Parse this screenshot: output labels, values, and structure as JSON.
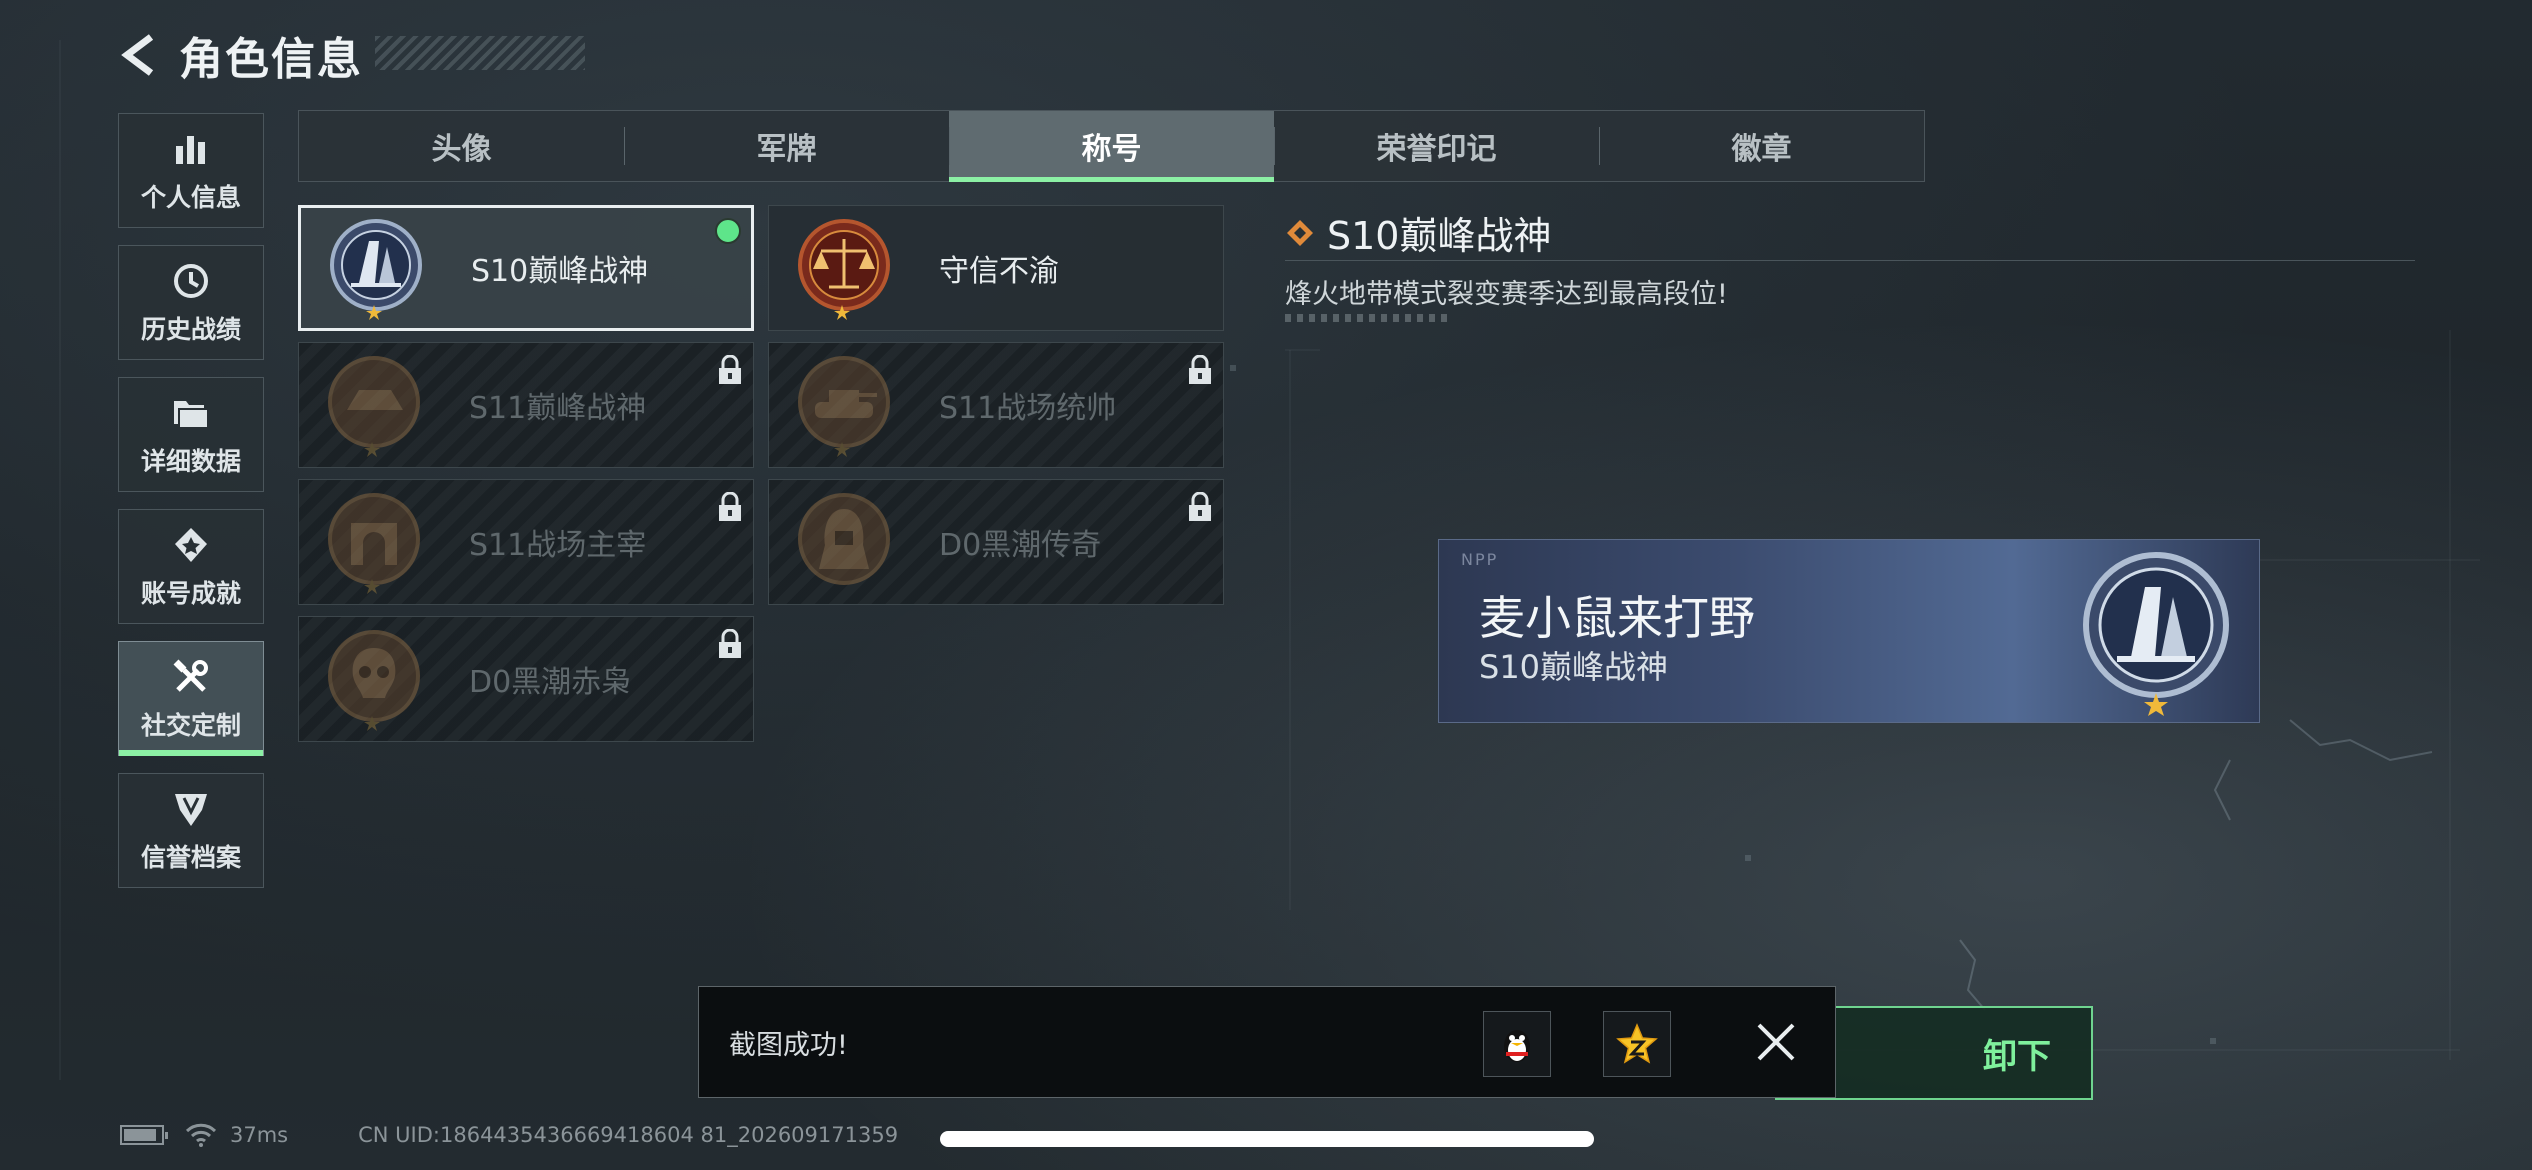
{
  "header": {
    "title": "角色信息",
    "back_icon": "chevron-left-icon"
  },
  "sidebar": {
    "items": [
      {
        "label": "个人信息",
        "icon": "bar-chart-icon",
        "active": false
      },
      {
        "label": "历史战绩",
        "icon": "history-clock-icon",
        "active": false
      },
      {
        "label": "详细数据",
        "icon": "folder-icon",
        "active": false
      },
      {
        "label": "账号成就",
        "icon": "achievement-icon",
        "active": false
      },
      {
        "label": "社交定制",
        "icon": "tools-icon",
        "active": true
      },
      {
        "label": "信誉档案",
        "icon": "shield-emblem-icon",
        "active": false
      }
    ]
  },
  "tabs": [
    {
      "label": "头像",
      "active": false
    },
    {
      "label": "军牌",
      "active": false
    },
    {
      "label": "称号",
      "active": true
    },
    {
      "label": "荣誉印记",
      "active": false
    },
    {
      "label": "徽章",
      "active": false
    }
  ],
  "titles": [
    {
      "name": "S10巅峰战神",
      "icon": "peak-god-emblem-icon",
      "locked": false,
      "selected": true,
      "equipped": true
    },
    {
      "name": "守信不渝",
      "icon": "scales-emblem-icon",
      "locked": false,
      "selected": false,
      "equipped": false
    },
    {
      "name": "S11巅峰战神",
      "icon": "s11-peak-emblem-icon",
      "locked": true
    },
    {
      "name": "S11战场统帅",
      "icon": "tank-emblem-icon",
      "locked": true
    },
    {
      "name": "S11战场主宰",
      "icon": "arch-emblem-icon",
      "locked": true
    },
    {
      "name": "D0黑潮传奇",
      "icon": "hooded-figure-emblem-icon",
      "locked": true
    },
    {
      "name": "D0黑潮赤枭",
      "icon": "skull-emblem-icon",
      "locked": true
    }
  ],
  "detail": {
    "title": "S10巅峰战神",
    "description": "烽火地带模式裂变赛季达到最高段位!"
  },
  "nameplate": {
    "player_name": "麦小鼠来打野",
    "title": "S10巅峰战神",
    "logo_text": "NPP"
  },
  "unequip_button": {
    "label": "卸下"
  },
  "toast": {
    "message": "截图成功!",
    "share_icons": [
      "qq-penguin-icon",
      "qzone-star-icon"
    ],
    "close_icon": "close-icon"
  },
  "footer": {
    "ping": "37ms",
    "uid": "CN UID:1864435436669418604 81_202609171359",
    "battery_level": 0.9
  },
  "colors": {
    "accent_green": "#8cf0a5",
    "equipped_dot": "#5ee58a"
  }
}
